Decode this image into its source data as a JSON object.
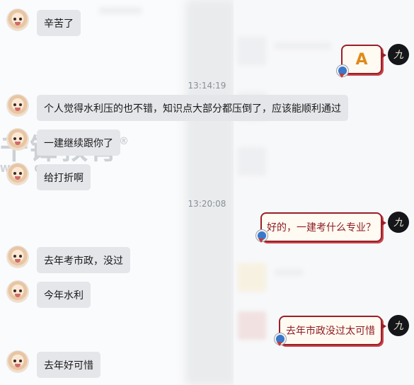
{
  "timestamps": [
    "13:14:19",
    "13:20:08"
  ],
  "watermark": {
    "main": "千锋教育",
    "sub": "W  F  ONLINE",
    "reg": "®"
  },
  "messages": [
    {
      "side": "in",
      "text": "辛苦了"
    },
    {
      "side": "out",
      "emoji": "A"
    },
    {
      "side": "in",
      "text": "个人觉得水利压的也不错，知识点大部分都压倒了，应该能顺利通过"
    },
    {
      "side": "in",
      "text": "一建继续跟你了"
    },
    {
      "side": "in",
      "text": "给打折啊"
    },
    {
      "side": "out",
      "text": "好的，一建考什么专业？"
    },
    {
      "side": "in",
      "text": "去年考市政，没过"
    },
    {
      "side": "in",
      "text": "今年水利"
    },
    {
      "side": "out",
      "text": "去年市政没过太可惜"
    },
    {
      "side": "in",
      "text": "去年好可惜"
    }
  ],
  "me_avatar_glyph": "九",
  "colors": {
    "incoming_bubble": "#e5e6ea",
    "outgoing_border": "#9a2028",
    "outgoing_text": "#8e1c22"
  }
}
